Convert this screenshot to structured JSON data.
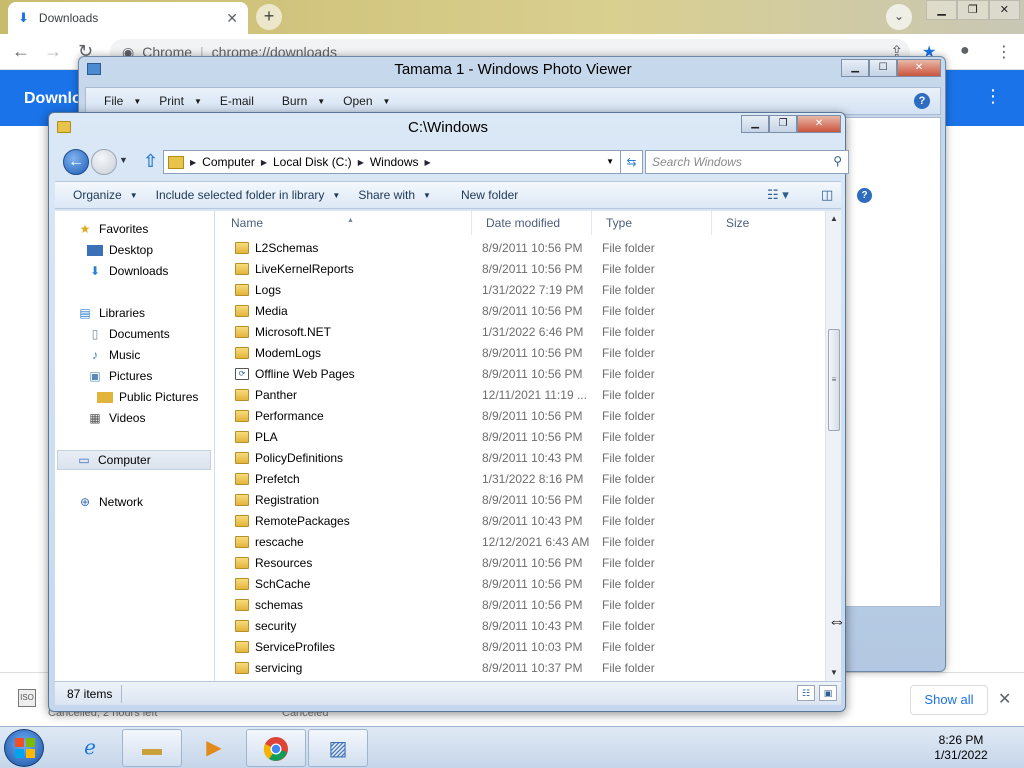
{
  "chrome": {
    "tab_title": "Downloads",
    "omnibox_label": "Chrome",
    "omnibox_url": "chrome://downloads",
    "page_header": "Downlo",
    "shelf": {
      "ghost_left": "Canceled",
      "ghost_left2": "Cancelled, 2 hours left",
      "show_all": "Show all"
    }
  },
  "photo_viewer": {
    "title": "Tamama 1 - Windows Photo Viewer",
    "menus": [
      {
        "label": "File"
      },
      {
        "label": "Print"
      },
      {
        "label": "E-mail"
      },
      {
        "label": "Burn"
      },
      {
        "label": "Open"
      }
    ]
  },
  "explorer": {
    "title": "C:\\Windows",
    "address": [
      "Computer",
      "Local Disk (C:)",
      "Windows"
    ],
    "search_placeholder": "Search Windows",
    "commands": {
      "organize": "Organize",
      "include": "Include selected folder in library",
      "share": "Share with",
      "new_folder": "New folder"
    },
    "nav": {
      "favorites": "Favorites",
      "desktop": "Desktop",
      "downloads": "Downloads",
      "libraries": "Libraries",
      "documents": "Documents",
      "music": "Music",
      "pictures": "Pictures",
      "public_pictures": "Public Pictures",
      "videos": "Videos",
      "computer": "Computer",
      "network": "Network"
    },
    "columns": {
      "name": "Name",
      "date": "Date modified",
      "type": "Type",
      "size": "Size"
    },
    "files": [
      {
        "name": "L2Schemas",
        "date": "8/9/2011 10:56 PM",
        "type": "File folder"
      },
      {
        "name": "LiveKernelReports",
        "date": "8/9/2011 10:56 PM",
        "type": "File folder"
      },
      {
        "name": "Logs",
        "date": "1/31/2022 7:19 PM",
        "type": "File folder"
      },
      {
        "name": "Media",
        "date": "8/9/2011 10:56 PM",
        "type": "File folder"
      },
      {
        "name": "Microsoft.NET",
        "date": "1/31/2022 6:46 PM",
        "type": "File folder"
      },
      {
        "name": "ModemLogs",
        "date": "8/9/2011 10:56 PM",
        "type": "File folder"
      },
      {
        "name": "Offline Web Pages",
        "date": "8/9/2011 10:56 PM",
        "type": "File folder",
        "special": true
      },
      {
        "name": "Panther",
        "date": "12/11/2021 11:19 ...",
        "type": "File folder"
      },
      {
        "name": "Performance",
        "date": "8/9/2011 10:56 PM",
        "type": "File folder"
      },
      {
        "name": "PLA",
        "date": "8/9/2011 10:56 PM",
        "type": "File folder"
      },
      {
        "name": "PolicyDefinitions",
        "date": "8/9/2011 10:43 PM",
        "type": "File folder"
      },
      {
        "name": "Prefetch",
        "date": "1/31/2022 8:16 PM",
        "type": "File folder"
      },
      {
        "name": "Registration",
        "date": "8/9/2011 10:56 PM",
        "type": "File folder"
      },
      {
        "name": "RemotePackages",
        "date": "8/9/2011 10:43 PM",
        "type": "File folder"
      },
      {
        "name": "rescache",
        "date": "12/12/2021 6:43 AM",
        "type": "File folder"
      },
      {
        "name": "Resources",
        "date": "8/9/2011 10:56 PM",
        "type": "File folder"
      },
      {
        "name": "SchCache",
        "date": "8/9/2011 10:56 PM",
        "type": "File folder"
      },
      {
        "name": "schemas",
        "date": "8/9/2011 10:56 PM",
        "type": "File folder"
      },
      {
        "name": "security",
        "date": "8/9/2011 10:43 PM",
        "type": "File folder"
      },
      {
        "name": "ServiceProfiles",
        "date": "8/9/2011 10:03 PM",
        "type": "File folder"
      },
      {
        "name": "servicing",
        "date": "8/9/2011 10:37 PM",
        "type": "File folder"
      }
    ],
    "status_count": "87 items"
  },
  "taskbar": {
    "time": "8:26 PM",
    "date": "1/31/2022"
  },
  "colors": {
    "chrome_blue": "#1a73e8",
    "aero_frame": "#c4d7ee",
    "folder_yellow": "#e2b43b"
  }
}
